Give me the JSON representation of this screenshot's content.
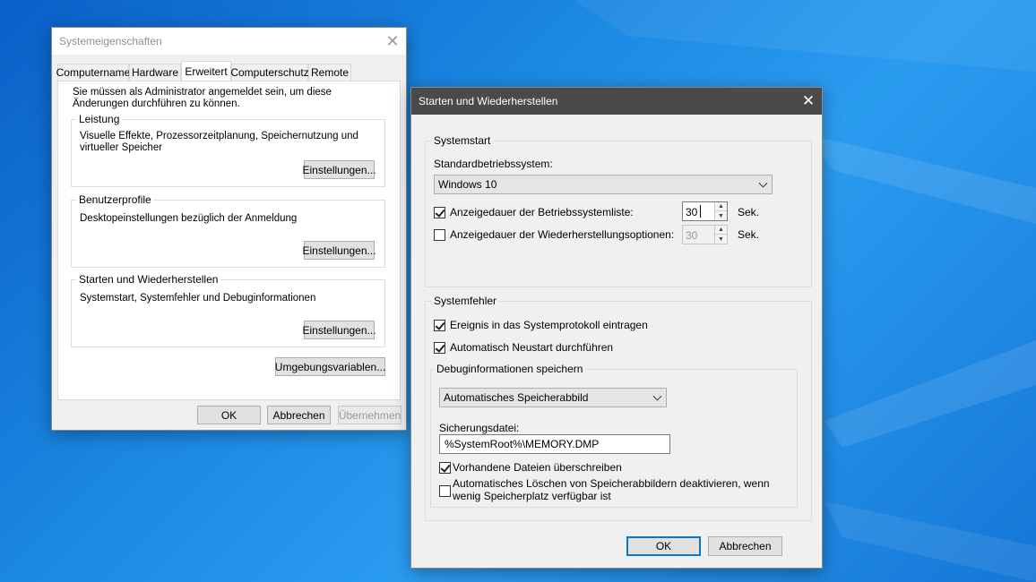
{
  "sys_dialog": {
    "title": "Systemeigenschaften",
    "tabs": [
      "Computername",
      "Hardware",
      "Erweitert",
      "Computerschutz",
      "Remote"
    ],
    "active_tab": "Erweitert",
    "admin_notice": "Sie müssen als Administrator angemeldet sein, um diese Änderungen durchführen zu können.",
    "groups": [
      {
        "label": "Leistung",
        "description": "Visuelle Effekte, Prozessorzeitplanung, Speichernutzung und virtueller Speicher",
        "button": "Einstellungen..."
      },
      {
        "label": "Benutzerprofile",
        "description": "Desktopeinstellungen bezüglich der Anmeldung",
        "button": "Einstellungen..."
      },
      {
        "label": "Starten und Wiederherstellen",
        "description": "Systemstart, Systemfehler und Debuginformationen",
        "button": "Einstellungen..."
      }
    ],
    "env_button": "Umgebungsvariablen...",
    "ok": "OK",
    "cancel": "Abbrechen",
    "apply": "Übernehmen"
  },
  "startup_dialog": {
    "title": "Starten und Wiederherstellen",
    "systemstart": {
      "label": "Systemstart",
      "default_os_label": "Standardbetriebssystem:",
      "default_os_value": "Windows 10",
      "show_list_label": "Anzeigedauer der Betriebssystemliste:",
      "show_list_checked": true,
      "show_list_value": "30",
      "show_recovery_label": "Anzeigedauer der Wiederherstellungsoptionen:",
      "show_recovery_checked": false,
      "show_recovery_value": "30",
      "unit": "Sek."
    },
    "systemfehler": {
      "label": "Systemfehler",
      "log_event_label": "Ereignis in das Systemprotokoll eintragen",
      "log_event_checked": true,
      "auto_restart_label": "Automatisch Neustart durchführen",
      "auto_restart_checked": true,
      "debug": {
        "label": "Debuginformationen speichern",
        "dump_type": "Automatisches Speicherabbild",
        "dump_file_label": "Sicherungsdatei:",
        "dump_file_value": "%SystemRoot%\\MEMORY.DMP",
        "overwrite_label": "Vorhandene Dateien überschreiben",
        "overwrite_checked": true,
        "disable_autodelete_label_line1": "Automatisches Löschen von Speicherabbildern deaktivieren, wenn",
        "disable_autodelete_label_line2": "wenig Speicherplatz verfügbar ist",
        "disable_autodelete_checked": false
      }
    },
    "ok": "OK",
    "cancel": "Abbrechen"
  },
  "colors": {
    "desktop": "#1a86e0",
    "titlebar_active": "#4a4a4a",
    "accent": "#0078d7"
  }
}
